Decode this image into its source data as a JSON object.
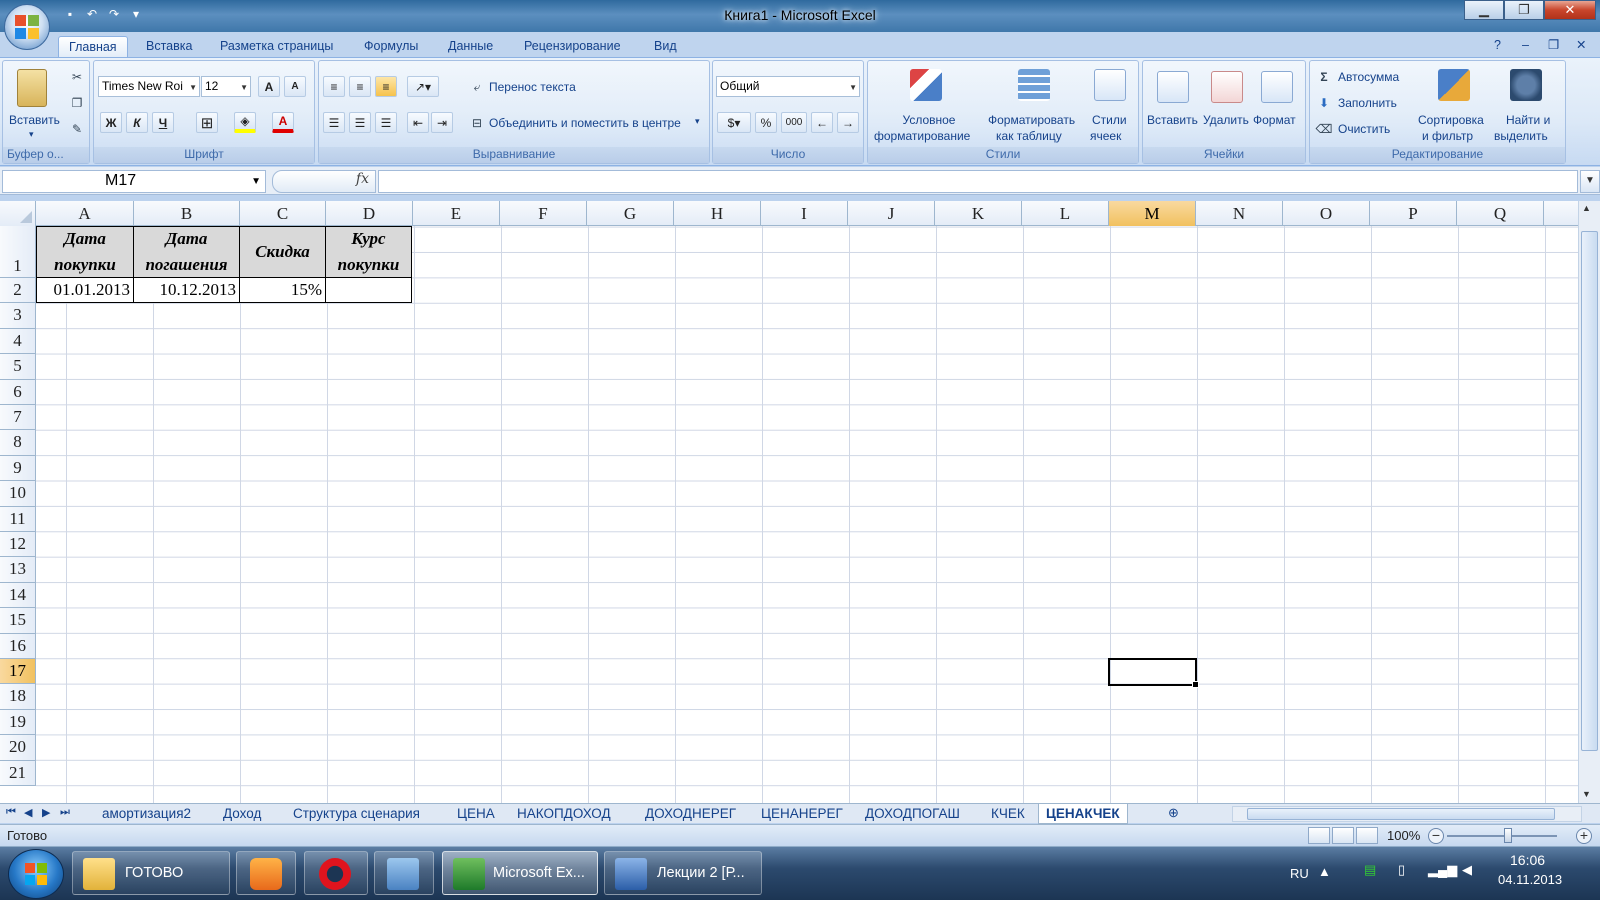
{
  "window": {
    "title": "Книга1 - Microsoft Excel"
  },
  "ribbon_tabs": [
    "Главная",
    "Вставка",
    "Разметка страницы",
    "Формулы",
    "Данные",
    "Рецензирование",
    "Вид"
  ],
  "ribbon": {
    "clipboard": {
      "paste": "Вставить",
      "label": "Буфер о..."
    },
    "font": {
      "name": "Times New Roi",
      "size": "12",
      "bold": "Ж",
      "italic": "К",
      "underline": "Ч",
      "grow": "A",
      "shrink": "A",
      "label": "Шрифт"
    },
    "alignment": {
      "wrap": "Перенос текста",
      "merge": "Объединить и поместить в центре",
      "label": "Выравнивание"
    },
    "number": {
      "format": "Общий",
      "percent": "%",
      "thousands": "000",
      "label": "Число"
    },
    "styles": {
      "conditional_1": "Условное",
      "conditional_2": "форматирование",
      "table_1": "Форматировать",
      "table_2": "как таблицу",
      "cell_1": "Стили",
      "cell_2": "ячеек",
      "label": "Стили"
    },
    "cells": {
      "insert": "Вставить",
      "delete": "Удалить",
      "format": "Формат",
      "label": "Ячейки"
    },
    "editing": {
      "autosum": "Автосумма",
      "fill": "Заполнить",
      "clear": "Очистить",
      "sort_1": "Сортировка",
      "sort_2": "и фильтр",
      "find_1": "Найти и",
      "find_2": "выделить",
      "label": "Редактирование"
    }
  },
  "formula_bar": {
    "name_box": "M17",
    "fx": "fx",
    "value": ""
  },
  "columns": [
    "A",
    "B",
    "C",
    "D",
    "E",
    "F",
    "G",
    "H",
    "I",
    "J",
    "K",
    "L",
    "M",
    "N",
    "O",
    "P",
    "Q"
  ],
  "rows": [
    "1",
    "2",
    "3",
    "4",
    "5",
    "6",
    "7",
    "8",
    "9",
    "10",
    "11",
    "12",
    "13",
    "14",
    "15",
    "16",
    "17",
    "18",
    "19",
    "20",
    "21"
  ],
  "cells": {
    "A1a": "Дата",
    "A1b": "покупки",
    "B1a": "Дата",
    "B1b": "погашения",
    "C1": "Скидка",
    "D1a": "Курс",
    "D1b": "покупки",
    "A2": "01.01.2013",
    "B2": "10.12.2013",
    "C2": "15%",
    "D2": ""
  },
  "selected_cell": "M17",
  "sheet_tabs": [
    "амортизация2",
    "Доход",
    "Структура сценария",
    "ЦЕНА",
    "НАКОПДОХОД",
    "ДОХОДНЕРЕГ",
    "ЦЕНАНЕРЕГ",
    "ДОХОДПОГАШ",
    "КЧЕК",
    "ЦЕНАКЧЕК"
  ],
  "active_sheet": "ЦЕНАКЧЕК",
  "status": {
    "ready": "Готово",
    "zoom": "100%"
  },
  "taskbar": {
    "items": [
      "ГОТОВО",
      "Microsoft Ex...",
      "Лекции 2 [Р..."
    ],
    "lang": "RU",
    "time": "16:06",
    "date": "04.11.2013"
  },
  "colors": {
    "accent": "#15428b",
    "selected_header": "#f1c15f",
    "header_fill": "#d9d9d9"
  }
}
